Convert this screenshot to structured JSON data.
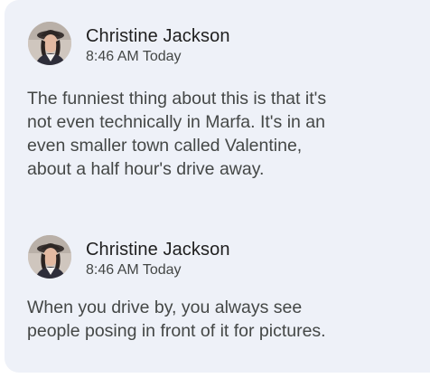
{
  "thread": {
    "messages": [
      {
        "author": "Christine Jackson",
        "timestamp": "8:46 AM Today",
        "avatar_icon": "user-avatar-photo",
        "body_lines": [
          "The funniest thing about this is that it's",
          "not even technically in Marfa. It's in an",
          "even smaller town called Valentine,",
          "about a half hour's drive away."
        ]
      },
      {
        "author": "Christine Jackson",
        "timestamp": "8:46 AM Today",
        "avatar_icon": "user-avatar-photo",
        "body_lines": [
          "When you drive by, you always see",
          "people posing in front of it for pictures."
        ]
      }
    ]
  },
  "colors": {
    "card_background": "#eef1f8",
    "author_text": "#1f1f1f",
    "secondary_text": "#444746"
  }
}
